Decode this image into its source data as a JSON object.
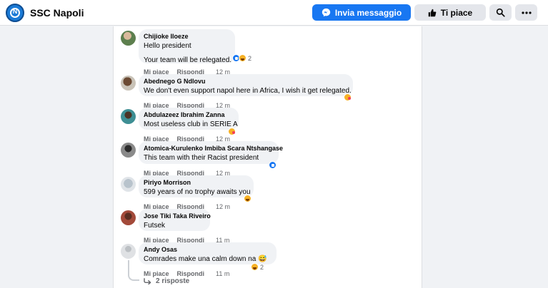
{
  "header": {
    "page_name": "SSC Napoli",
    "message_button": "Invia messaggio",
    "like_button": "Ti piace",
    "logo_icon": "ssc-napoli-logo",
    "search_icon": "search-icon",
    "more_icon": "more-icon"
  },
  "actions": {
    "like": "Mi piace",
    "reply": "Rispondi"
  },
  "comments": [
    {
      "author": "Chijioke Iloeze",
      "texts": [
        "Hello president",
        "Your team will be relegated."
      ],
      "time": "12 m",
      "reactions": [
        "like",
        "haha"
      ],
      "reaction_count": "2"
    },
    {
      "author": "Abednego G Ndlovu",
      "texts": [
        "We don't even support napol here in Africa, I wish it get relegated."
      ],
      "time": "12 m",
      "reactions": [
        "care"
      ],
      "reaction_count": ""
    },
    {
      "author": "Abdulazeez Ibrahim Zanna",
      "texts": [
        "Most useless club in SERIE A"
      ],
      "time": "12 m",
      "reactions": [
        "care"
      ],
      "reaction_count": ""
    },
    {
      "author": "Atomica-Kurulenko Imbiba Scara Ntshangase",
      "texts": [
        "This team with their Racist president"
      ],
      "time": "12 m",
      "reactions": [
        "like"
      ],
      "reaction_count": ""
    },
    {
      "author": "Piriyo Morrison",
      "texts": [
        "599 years of no trophy awaits you"
      ],
      "time": "12 m",
      "reactions": [
        "haha"
      ],
      "reaction_count": ""
    },
    {
      "author": "Jose Tiki Taka Riveiro",
      "texts": [
        "Futsek"
      ],
      "time": "11 m",
      "reactions": [],
      "reaction_count": ""
    },
    {
      "author": "Andy Osas",
      "texts": [
        "Comrades make una calm down na 😅"
      ],
      "time": "11 m",
      "reactions": [
        "haha"
      ],
      "reaction_count": "2",
      "replies_label": "2 risposte"
    }
  ],
  "colors": {
    "accent": "#1877f2",
    "bubble": "#f0f2f5",
    "meta": "#65676b"
  }
}
